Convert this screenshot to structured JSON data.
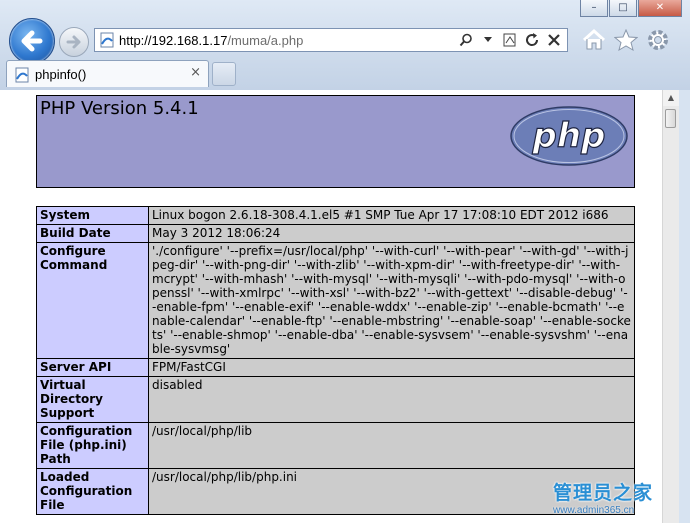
{
  "browser": {
    "address": {
      "url_host": "http://192.168.1.17",
      "url_path": "/muma/a.php"
    },
    "tab": {
      "title": "phpinfo()",
      "close_glyph": "×"
    },
    "window_controls": {
      "minimize": "–",
      "maximize": "□",
      "close": "✕"
    },
    "icons": [
      "back-arrow-icon",
      "forward-arrow-icon",
      "page-icon",
      "search-icon",
      "dropdown-icon",
      "compatibility-view-icon",
      "refresh-icon",
      "stop-icon",
      "home-icon",
      "favorites-star-icon",
      "settings-gear-icon"
    ]
  },
  "page": {
    "header": {
      "title": "PHP Version 5.4.1",
      "logo_text": "php"
    },
    "colors": {
      "header_bg": "#9999cc",
      "key_cell_bg": "#ccccff",
      "value_cell_bg": "#cccccc"
    },
    "rows": [
      {
        "key": "System",
        "value": "Linux bogon 2.6.18-308.4.1.el5 #1 SMP Tue Apr 17 17:08:10 EDT 2012 i686"
      },
      {
        "key": "Build Date",
        "value": "May 3 2012 18:06:24"
      },
      {
        "key": "Configure Command",
        "value": "'./configure' '--prefix=/usr/local/php' '--with-curl' '--with-pear' '--with-gd' '--with-jpeg-dir' '--with-png-dir' '--with-zlib' '--with-xpm-dir' '--with-freetype-dir' '--with-mcrypt' '--with-mhash' '--with-mysql' '--with-mysqli' '--with-pdo-mysql' '--with-openssl' '--with-xmlrpc' '--with-xsl' '--with-bz2' '--with-gettext' '--disable-debug' '--enable-fpm' '--enable-exif' '--enable-wddx' '--enable-zip' '--enable-bcmath' '--enable-calendar' '--enable-ftp' '--enable-mbstring' '--enable-soap' '--enable-sockets' '--enable-shmop' '--enable-dba' '--enable-sysvsem' '--enable-sysvshm' '--enable-sysvmsg'"
      },
      {
        "key": "Server API",
        "value": "FPM/FastCGI"
      },
      {
        "key": "Virtual Directory Support",
        "value": "disabled"
      },
      {
        "key": "Configuration File (php.ini) Path",
        "value": "/usr/local/php/lib"
      },
      {
        "key": "Loaded Configuration File",
        "value": "/usr/local/php/lib/php.ini"
      }
    ]
  },
  "watermark": {
    "brand": "管理员之家",
    "url": "www.admin365.cn"
  }
}
